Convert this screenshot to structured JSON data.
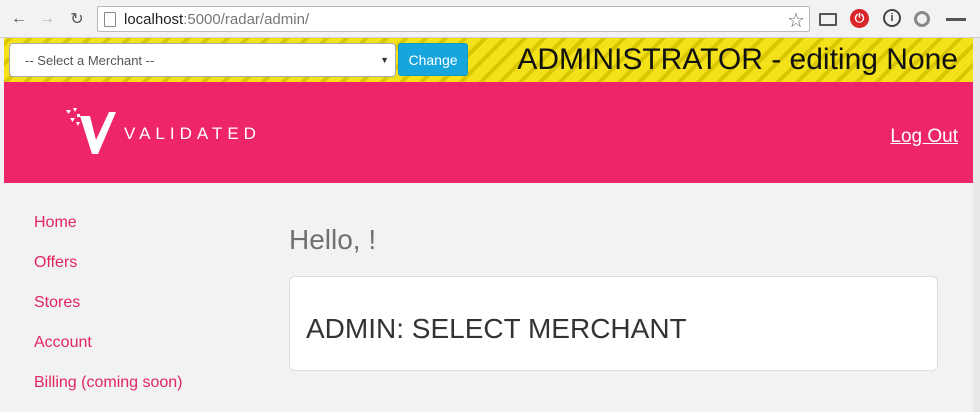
{
  "browser": {
    "url_host": "localhost",
    "url_path": ":5000/radar/admin/"
  },
  "admin_bar": {
    "select_value": "-- Select a Merchant --",
    "change_label": "Change",
    "title": "ADMINISTRATOR - editing None"
  },
  "header": {
    "logo_text": "VALIDATED",
    "logout_label": "Log Out"
  },
  "sidebar": {
    "items": [
      {
        "label": "Home"
      },
      {
        "label": "Offers"
      },
      {
        "label": "Stores"
      },
      {
        "label": "Account"
      },
      {
        "label": "Billing (coming soon)"
      }
    ]
  },
  "main": {
    "greeting": "Hello, !",
    "panel_title": "ADMIN: SELECT MERCHANT"
  },
  "colors": {
    "brand_pink": "#ee2568",
    "admin_yellow": "#f3e11a",
    "button_blue": "#16a5dd"
  }
}
